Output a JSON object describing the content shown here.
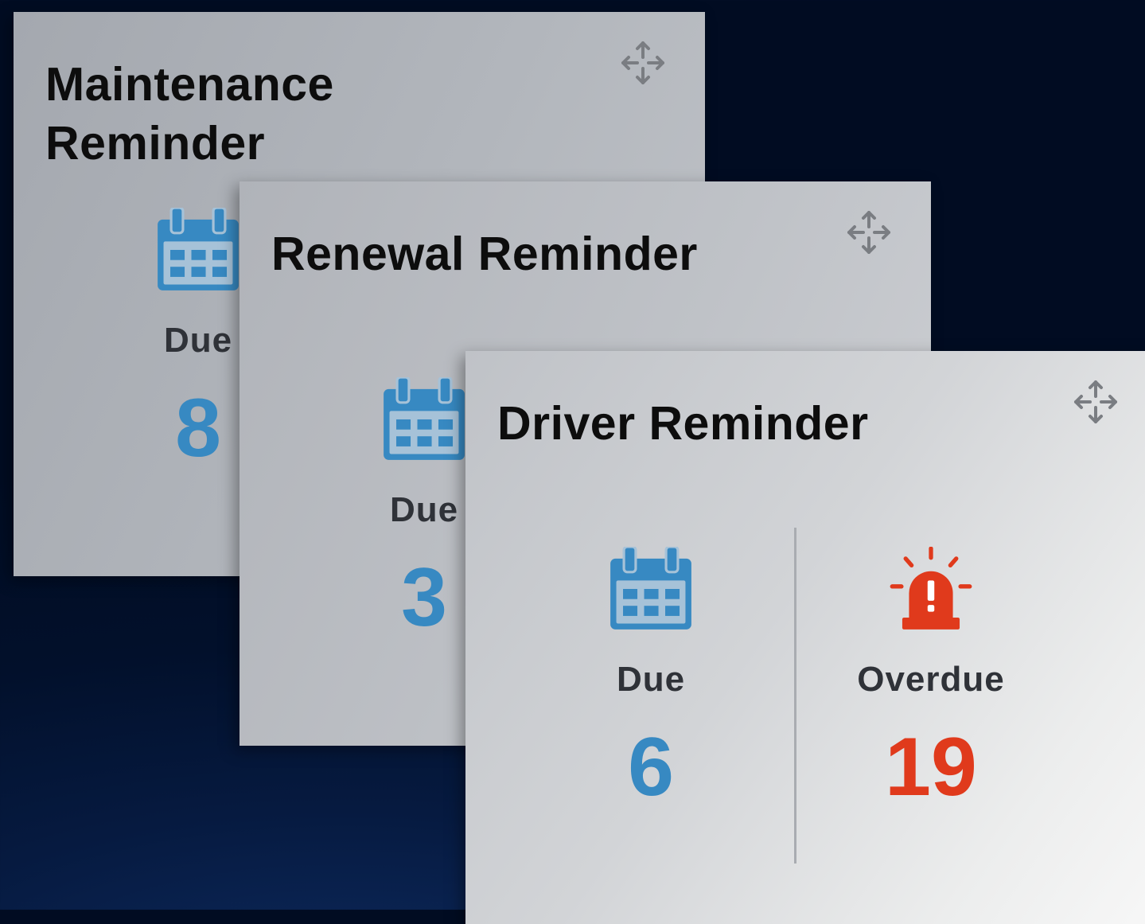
{
  "colors": {
    "accent_blue": "#3789c2",
    "alert_red": "#e03a1c",
    "move_icon": "#7a7d82"
  },
  "cards": {
    "maintenance": {
      "title": "Maintenance Reminder",
      "move_icon": "move-arrows-icon",
      "due": {
        "icon": "calendar-icon",
        "label": "Due",
        "value": "8"
      }
    },
    "renewal": {
      "title": "Renewal Reminder",
      "move_icon": "move-arrows-icon",
      "due": {
        "icon": "calendar-icon",
        "label": "Due",
        "value": "3"
      }
    },
    "driver": {
      "title": "Driver Reminder",
      "move_icon": "move-arrows-icon",
      "due": {
        "icon": "calendar-icon",
        "label": "Due",
        "value": "6"
      },
      "overdue": {
        "icon": "alarm-siren-icon",
        "label": "Overdue",
        "value": "19"
      }
    }
  }
}
